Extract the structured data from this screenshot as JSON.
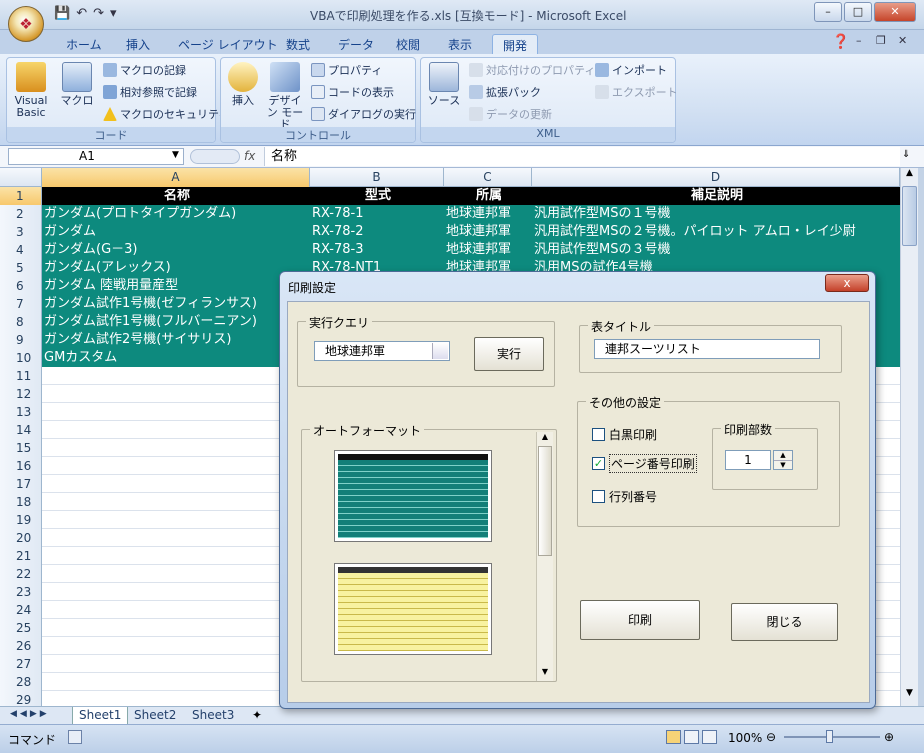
{
  "window": {
    "title": "VBAで印刷処理を作る.xls  [互換モード] - Microsoft Excel",
    "minimize": "–",
    "maximize": "□",
    "close": "✕"
  },
  "office_button_glyph": "❖",
  "ribbon_tabs": [
    "ホーム",
    "挿入",
    "ページ レイアウト",
    "数式",
    "データ",
    "校閲",
    "表示",
    "開発"
  ],
  "selected_tab": "開発",
  "ribbon": {
    "code": {
      "label": "コード",
      "visual_basic": "Visual Basic",
      "macro": "マクロ",
      "record_macro": "マクロの記録",
      "relative_ref": "相対参照で記録",
      "macro_security": "マクロのセキュリティ"
    },
    "control": {
      "label": "コントロール",
      "insert": "挿入",
      "design_mode": "デザイン モード",
      "properties": "プロパティ",
      "view_code": "コードの表示",
      "run_dialog": "ダイアログの実行"
    },
    "xml": {
      "label": "XML",
      "source": "ソース",
      "map_properties": "対応付けのプロパティ",
      "expansion_packs": "拡張パック",
      "refresh_data": "データの更新",
      "import": "インポート",
      "export": "エクスポート"
    }
  },
  "formula_bar": {
    "name_box": "A1",
    "fx": "fx",
    "formula": "名称"
  },
  "columns": [
    "A",
    "B",
    "C",
    "D"
  ],
  "table": {
    "headers": [
      "名称",
      "型式",
      "所属",
      "補足説明"
    ],
    "rows": [
      [
        "ガンダム(プロトタイプガンダム)",
        "RX-78-1",
        "地球連邦軍",
        "汎用試作型MSの１号機"
      ],
      [
        "ガンダム",
        "RX-78-2",
        "地球連邦軍",
        "汎用試作型MSの２号機。パイロット アムロ・レイ少尉"
      ],
      [
        "ガンダム(G－3)",
        "RX-78-3",
        "地球連邦軍",
        "汎用試作型MSの３号機"
      ],
      [
        "ガンダム(アレックス)",
        "RX-78-NT1",
        "地球連邦軍",
        "汎用MSの試作4号機"
      ],
      [
        "ガンダム 陸戦用量産型",
        "",
        "",
        ""
      ],
      [
        "ガンダム試作1号機(ゼフィランサス)",
        "",
        "",
        ""
      ],
      [
        "ガンダム試作1号機(フルバーニアン)",
        "",
        "",
        ""
      ],
      [
        "ガンダム試作2号機(サイサリス)",
        "",
        "",
        ""
      ],
      [
        "GMカスタム",
        "",
        "",
        ""
      ]
    ]
  },
  "row_numbers": [
    "1",
    "2",
    "3",
    "4",
    "5",
    "6",
    "7",
    "8",
    "9",
    "10",
    "11",
    "12",
    "13",
    "14",
    "15",
    "16",
    "17",
    "18",
    "19",
    "20",
    "21",
    "22",
    "23",
    "24",
    "25",
    "26",
    "27",
    "28",
    "29"
  ],
  "sheet_tabs": [
    "Sheet1",
    "Sheet2",
    "Sheet3"
  ],
  "active_sheet": "Sheet1",
  "status": {
    "mode": "コマンド",
    "zoom": "100%"
  },
  "dialog": {
    "title": "印刷設定",
    "query_frame": "実行クエリ",
    "query_value": "地球連邦軍",
    "run_button": "実行",
    "title_frame": "表タイトル",
    "title_value": "連邦スーツリスト",
    "other_frame": "その他の設定",
    "bw_print": "白黒印刷",
    "bw_checked": false,
    "page_number_print": "ページ番号印刷",
    "page_number_checked": true,
    "row_col_number": "行列番号",
    "row_col_checked": false,
    "copies_frame": "印刷部数",
    "copies_value": "1",
    "autoformat_frame": "オートフォーマット",
    "print_button": "印刷",
    "close_button": "閉じる",
    "close_x": "x"
  },
  "colors": {
    "header_row": "#000000",
    "data_row": "#0d8a7e",
    "thumb_teal": "#137f78",
    "thumb_yellow": "#f8f2a0"
  }
}
